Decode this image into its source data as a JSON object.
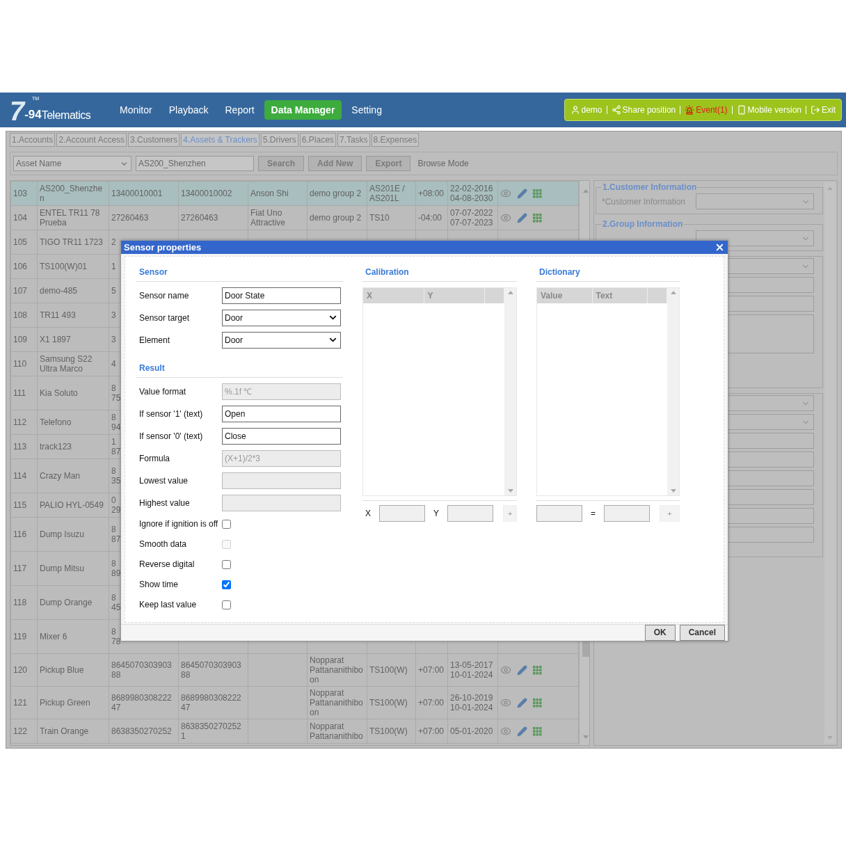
{
  "logo": {
    "mark": "7",
    "tm": "TM",
    "sub": "-94",
    "name": "Telematics"
  },
  "nav": [
    {
      "label": "Monitor",
      "selected": false
    },
    {
      "label": "Playback",
      "selected": false
    },
    {
      "label": "Report",
      "selected": false
    },
    {
      "label": "Data Manager",
      "selected": true
    },
    {
      "label": "Setting",
      "selected": false
    }
  ],
  "user_bar": [
    {
      "kind": "user",
      "label": "demo"
    },
    {
      "kind": "share",
      "label": "Share position"
    },
    {
      "kind": "event",
      "label": "Event(1)"
    },
    {
      "kind": "mobile",
      "label": "Mobile version"
    },
    {
      "kind": "exit",
      "label": "Exit"
    }
  ],
  "tabs": [
    {
      "label": "1.Accounts",
      "selected": false
    },
    {
      "label": "2.Account Access",
      "selected": false
    },
    {
      "label": "3.Customers",
      "selected": false
    },
    {
      "label": "4.Assets & Trackers",
      "selected": true
    },
    {
      "label": "5.Drivers",
      "selected": false
    },
    {
      "label": "6.Places",
      "selected": false
    },
    {
      "label": "7.Tasks",
      "selected": false
    },
    {
      "label": "8.Expenses",
      "selected": false
    }
  ],
  "toolbar": {
    "filter": "Asset Name",
    "search_value": "AS200_Shenzhen",
    "buttons": [
      "Search",
      "Add New",
      "Export"
    ],
    "mode": "Browse Mode"
  },
  "table": {
    "rows": [
      {
        "selected": true,
        "cells": [
          "103",
          "AS200_Shenzhen",
          "13400010001",
          "13400010002",
          "Anson Shi",
          "demo group 2",
          "AS201E / AS201L",
          "+08:00",
          "22-02-2016\n04-08-2030"
        ],
        "actions": true
      },
      {
        "selected": false,
        "cells": [
          "104",
          "ENTEL TR11 78 Prueba",
          "27260463",
          "27260463",
          "Fiat Uno Attractive",
          "demo group 2",
          "TS10",
          "-04:00",
          "07-07-2022\n07-07-2023"
        ],
        "actions": true
      },
      {
        "selected": false,
        "cells": [
          "105",
          "TIGO TR11 1723",
          "2"
        ],
        "actions": false
      },
      {
        "selected": false,
        "cells": [
          "106",
          "TS100(W)01",
          "1"
        ],
        "actions": false
      },
      {
        "selected": false,
        "cells": [
          "107",
          "demo-485",
          "5"
        ],
        "actions": false
      },
      {
        "selected": false,
        "cells": [
          "108",
          "TR11 493",
          "3"
        ],
        "actions": false
      },
      {
        "selected": false,
        "cells": [
          "109",
          "X1 1897",
          "3"
        ],
        "actions": false
      },
      {
        "selected": false,
        "cells": [
          "110",
          "Samsung S22 Ultra Marco",
          "4"
        ],
        "actions": false
      },
      {
        "selected": false,
        "cells": [
          "111",
          "Kia Soluto",
          "8\n75"
        ],
        "actions": false
      },
      {
        "selected": false,
        "cells": [
          "112",
          "Telefono",
          "8\n94"
        ],
        "actions": false
      },
      {
        "selected": false,
        "cells": [
          "113",
          "track123",
          "1\n87"
        ],
        "actions": false
      },
      {
        "selected": false,
        "cells": [
          "114",
          "Crazy Man",
          "8\n35"
        ],
        "actions": false
      },
      {
        "selected": false,
        "cells": [
          "115",
          "PALIO HYL-0549",
          "0\n29"
        ],
        "actions": false
      },
      {
        "selected": false,
        "cells": [
          "116",
          "Dump Isuzu",
          "8\n87"
        ],
        "actions": false
      },
      {
        "selected": false,
        "cells": [
          "117",
          "Dump Mitsu",
          "8\n89"
        ],
        "actions": false
      },
      {
        "selected": false,
        "cells": [
          "118",
          "Dump Orange",
          "8\n45"
        ],
        "actions": false
      },
      {
        "selected": false,
        "cells": [
          "119",
          "Mixer 6",
          "8\n78"
        ],
        "actions": false
      },
      {
        "selected": false,
        "cells": [
          "120",
          "Pickup Blue",
          "864507030390388",
          "864507030390388",
          "",
          "Nopparat Pattananithiboon",
          "TS100(W)",
          "+07:00",
          "13-05-2017\n10-01-2024"
        ],
        "actions": true
      },
      {
        "selected": false,
        "cells": [
          "121",
          "Pickup Green",
          "868998030822247",
          "868998030822247",
          "",
          "Nopparat Pattananithiboon",
          "TS100(W)",
          "+07:00",
          "26-10-2019\n10-01-2024"
        ],
        "actions": true
      },
      {
        "selected": false,
        "cells": [
          "122",
          "Train Orange",
          "8638350270252",
          "86383502702521",
          "",
          "Nopparat Pattananithibo",
          "TS100(W)",
          "+07:00",
          "05-01-2020"
        ],
        "actions": true
      }
    ]
  },
  "right_panel": {
    "sections": [
      {
        "title": "1.Customer Information",
        "label": "*Customer Information",
        "fields": [
          {
            "kind": "select"
          }
        ]
      },
      {
        "title": "2.Group Information",
        "fields": [
          {
            "kind": "select"
          }
        ]
      },
      {
        "fields": [
          {
            "kind": "select"
          },
          {
            "kind": "text"
          },
          {
            "kind": "text"
          },
          {
            "kind": "textarea"
          }
        ]
      },
      {
        "fields": [
          {
            "kind": "select"
          },
          {
            "kind": "select"
          },
          {
            "kind": "text"
          },
          {
            "kind": "text"
          },
          {
            "kind": "text"
          },
          {
            "kind": "text"
          },
          {
            "kind": "text"
          },
          {
            "kind": "text"
          }
        ]
      }
    ]
  },
  "dialog": {
    "title": "Sensor properties",
    "groups": [
      {
        "heading": "Sensor",
        "fields": [
          {
            "label": "Sensor name",
            "kind": "text",
            "value": "Door State",
            "disabled": false
          },
          {
            "label": "Sensor target",
            "kind": "select",
            "value": "Door"
          },
          {
            "label": "Element",
            "kind": "select",
            "value": "Door"
          }
        ]
      },
      {
        "heading": "Result",
        "fields": [
          {
            "label": "Value format",
            "kind": "text",
            "placeholder": "%.1f ℃",
            "disabled": true
          },
          {
            "label": "If sensor '1' (text)",
            "kind": "text",
            "value": "Open",
            "disabled": false
          },
          {
            "label": "If sensor '0' (text)",
            "kind": "text",
            "value": "Close",
            "disabled": false
          },
          {
            "label": "Formula",
            "kind": "text",
            "placeholder": "(X+1)/2*3",
            "disabled": true
          },
          {
            "label": "Lowest value",
            "kind": "text",
            "disabled": true
          },
          {
            "label": "Highest value",
            "kind": "text",
            "disabled": true
          }
        ]
      }
    ],
    "checkboxes": [
      {
        "label": "Ignore if ignition is off",
        "checked": false,
        "disabled": false
      },
      {
        "label": "Smooth data",
        "checked": false,
        "disabled": true
      },
      {
        "label": "Reverse digital",
        "checked": false,
        "disabled": false
      },
      {
        "label": "Show time",
        "checked": true,
        "disabled": false
      },
      {
        "label": "Keep last value",
        "checked": false,
        "disabled": false
      }
    ],
    "lists": [
      {
        "heading": "Calibration",
        "columns": [
          "X",
          "Y"
        ],
        "input_labels": [
          "X",
          "Y"
        ],
        "add": "+"
      },
      {
        "heading": "Dictionary",
        "columns": [
          "Value",
          "Text"
        ],
        "separator": "=",
        "add": "+"
      }
    ],
    "buttons": [
      "OK",
      "Cancel"
    ]
  }
}
